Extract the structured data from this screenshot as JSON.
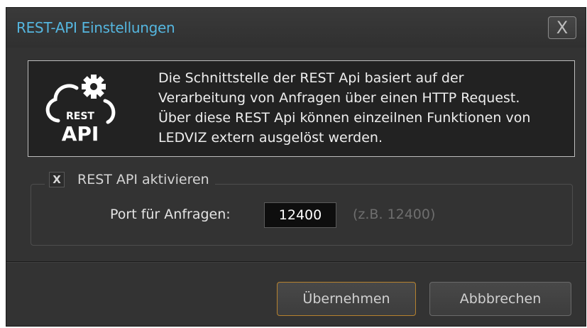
{
  "window": {
    "title": "REST-API Einstellungen",
    "close_label": "X"
  },
  "info": {
    "logo_text_top": "REST",
    "logo_text_bottom": "API",
    "lines": [
      "Die Schnittstelle der REST Api basiert auf der",
      "Verarbeitung von Anfragen über einen HTTP Request.",
      "Über diese REST Api können einzeilnen Funktionen von",
      "LEDVIZ extern ausgelöst werden."
    ]
  },
  "settings": {
    "enable_checkbox_mark": "X",
    "enable_checked": true,
    "enable_label": "REST API aktivieren",
    "port_label": "Port für Anfragen:",
    "port_value": "12400",
    "port_hint": "(z.B. 12400)"
  },
  "buttons": {
    "apply_label": "Übernehmen",
    "cancel_label": "Abbbrechen"
  },
  "colors": {
    "title_accent": "#55b6df",
    "apply_border": "#b6822f",
    "dialog_bg": "#333333"
  },
  "icons": {
    "logo": "rest-api-cloud-gear-icon"
  }
}
